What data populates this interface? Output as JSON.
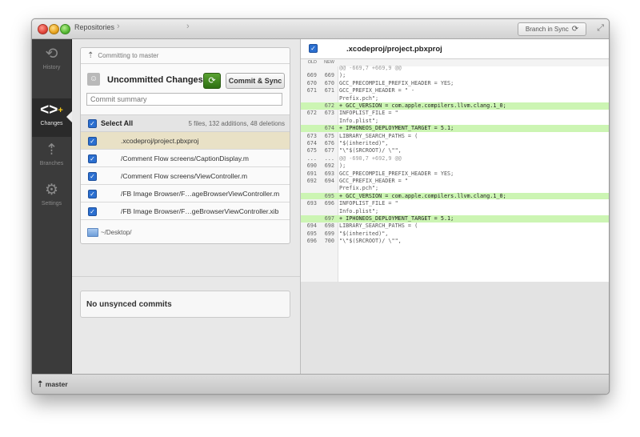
{
  "titlebar": {
    "breadcrumb": "Repositories",
    "sync_label": "Branch in Sync"
  },
  "sidebar": {
    "items": [
      {
        "label": "History",
        "icon": "history-icon"
      },
      {
        "label": "Changes",
        "icon": "changes-icon"
      },
      {
        "label": "Branches",
        "icon": "branches-icon"
      },
      {
        "label": "Settings",
        "icon": "settings-icon"
      }
    ]
  },
  "commit": {
    "committing_to": "Committing to master",
    "title": "Uncommitted Changes",
    "commit_button": "Commit & Sync",
    "summary_placeholder": "Commit summary",
    "select_all": "Select All",
    "file_count": "5 files, 132 additions, 48 deletions",
    "files": [
      ".xcodeproj/project.pbxproj",
      "/Comment Flow screens/CaptionDisplay.m",
      "/Comment Flow screens/ViewController.m",
      "/FB Image Browser/F…ageBrowserViewController.m",
      "/FB Image Browser/F…geBrowserViewController.xib"
    ],
    "folder": "~/Desktop/"
  },
  "unsynced": {
    "label": "No unsynced commits"
  },
  "diff": {
    "title": ".xcodeproj/project.pbxproj",
    "col_old": "OLD",
    "col_new": "NEW",
    "lines": [
      {
        "old": "",
        "new": "",
        "text": "@@ -669,7 +669,9 @@",
        "kind": "hunk"
      },
      {
        "old": "669",
        "new": "669",
        "text": "                     );",
        "kind": "ctx"
      },
      {
        "old": "670",
        "new": "670",
        "text": "                     GCC_PRECOMPILE_PREFIX_HEADER = YES;",
        "kind": "ctx"
      },
      {
        "old": "671",
        "new": "671",
        "text": "                     GCC_PREFIX_HEADER = \"                        -",
        "kind": "ctx"
      },
      {
        "old": "",
        "new": "",
        "text": "Prefix.pch\";",
        "kind": "wrap"
      },
      {
        "old": "",
        "new": "672",
        "text": "+                    GCC_VERSION = com.apple.compilers.llvm.clang.1_0;",
        "kind": "added"
      },
      {
        "old": "672",
        "new": "673",
        "text": "                     INFOPLIST_FILE = \"",
        "kind": "ctx"
      },
      {
        "old": "",
        "new": "",
        "text": "Info.plist\";",
        "kind": "wrap"
      },
      {
        "old": "",
        "new": "674",
        "text": "+                    IPHONEOS_DEPLOYMENT_TARGET = 5.1;",
        "kind": "added"
      },
      {
        "old": "673",
        "new": "675",
        "text": "                     LIBRARY_SEARCH_PATHS = (",
        "kind": "ctx"
      },
      {
        "old": "674",
        "new": "676",
        "text": "                        \"$(inherited)\",",
        "kind": "ctx"
      },
      {
        "old": "675",
        "new": "677",
        "text": "                        \"\\\"$(SRCROOT)/      \\\"\",",
        "kind": "ctx"
      },
      {
        "old": "...",
        "new": "...",
        "text": "@@ -690,7 +692,9 @@",
        "kind": "hunk"
      },
      {
        "old": "690",
        "new": "692",
        "text": "                     );",
        "kind": "ctx"
      },
      {
        "old": "691",
        "new": "693",
        "text": "                     GCC_PRECOMPILE_PREFIX_HEADER = YES;",
        "kind": "ctx"
      },
      {
        "old": "692",
        "new": "694",
        "text": "                     GCC_PREFIX_HEADER = \"",
        "kind": "ctx"
      },
      {
        "old": "",
        "new": "",
        "text": "Prefix.pch\";",
        "kind": "wrap"
      },
      {
        "old": "",
        "new": "695",
        "text": "+                    GCC_VERSION = com.apple.compilers.llvm.clang.1_0;",
        "kind": "added"
      },
      {
        "old": "693",
        "new": "696",
        "text": "                     INFOPLIST_FILE = \"",
        "kind": "ctx"
      },
      {
        "old": "",
        "new": "",
        "text": "Info.plist\";",
        "kind": "wrap"
      },
      {
        "old": "",
        "new": "697",
        "text": "+                    IPHONEOS_DEPLOYMENT_TARGET = 5.1;",
        "kind": "added"
      },
      {
        "old": "694",
        "new": "698",
        "text": "                     LIBRARY_SEARCH_PATHS = (",
        "kind": "ctx"
      },
      {
        "old": "695",
        "new": "699",
        "text": "                        \"$(inherited)\",",
        "kind": "ctx"
      },
      {
        "old": "696",
        "new": "700",
        "text": "                        \"\\\"$(SRCROOT)/      \\\"\",",
        "kind": "ctx"
      }
    ]
  },
  "statusbar": {
    "branch": "master"
  },
  "colors": {
    "accent": "#2b6fd0",
    "added_line": "#ccf5b3",
    "sync_green": "#3f8a1f"
  }
}
